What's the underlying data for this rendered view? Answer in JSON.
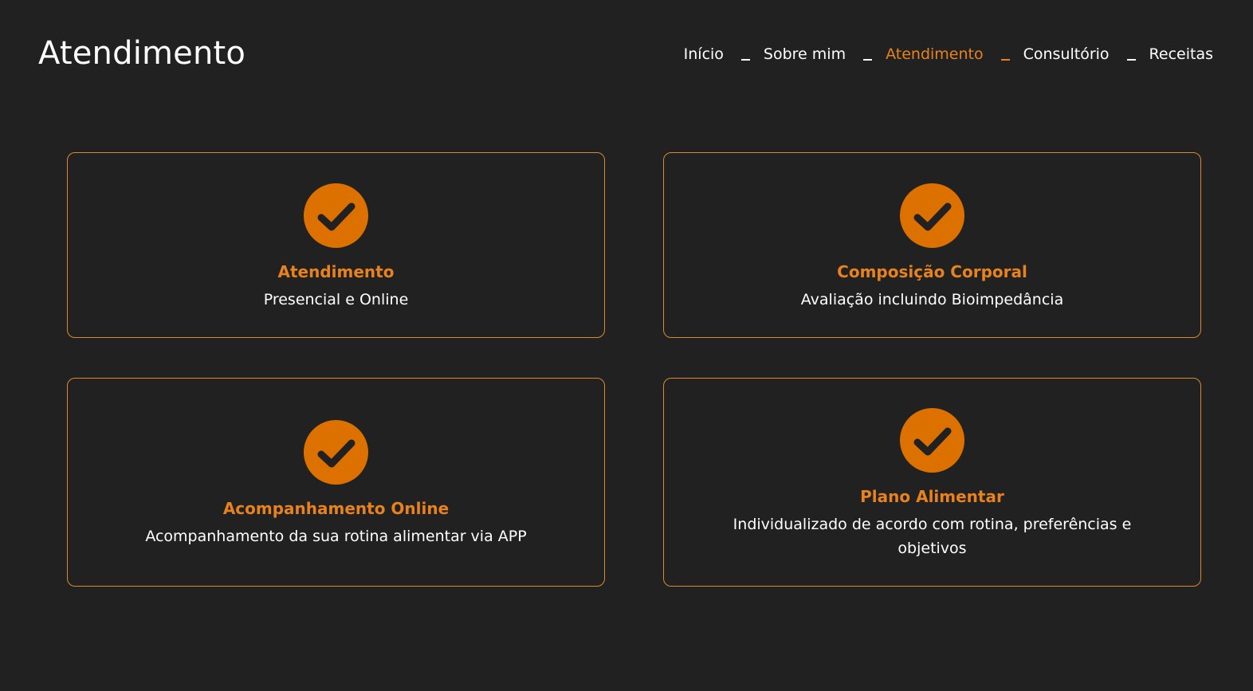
{
  "header": {
    "title": "Atendimento"
  },
  "nav": {
    "items": [
      {
        "label": "Início"
      },
      {
        "label": "Sobre mim"
      },
      {
        "label": "Atendimento"
      },
      {
        "label": "Consultório"
      },
      {
        "label": "Receitas"
      }
    ],
    "active_color": "#e8821e"
  },
  "cards": [
    {
      "icon": "check-circle-icon",
      "title": "Atendimento",
      "text": "Presencial e Online"
    },
    {
      "icon": "check-circle-icon",
      "title": "Composição Corporal",
      "text": "Avaliação incluindo Bioimpedância"
    },
    {
      "icon": "check-circle-icon",
      "title": "Acompanhamento Online",
      "text": "Acompanhamento da sua rotina alimentar via APP"
    },
    {
      "icon": "check-circle-icon",
      "title": "Plano Alimentar",
      "text": "Individualizado de acordo com rotina, preferências e objetivos"
    }
  ],
  "colors": {
    "background": "#212121",
    "accent": "#e8821e",
    "icon_fill": "#dd7100",
    "card_border": "#d98a2c"
  }
}
